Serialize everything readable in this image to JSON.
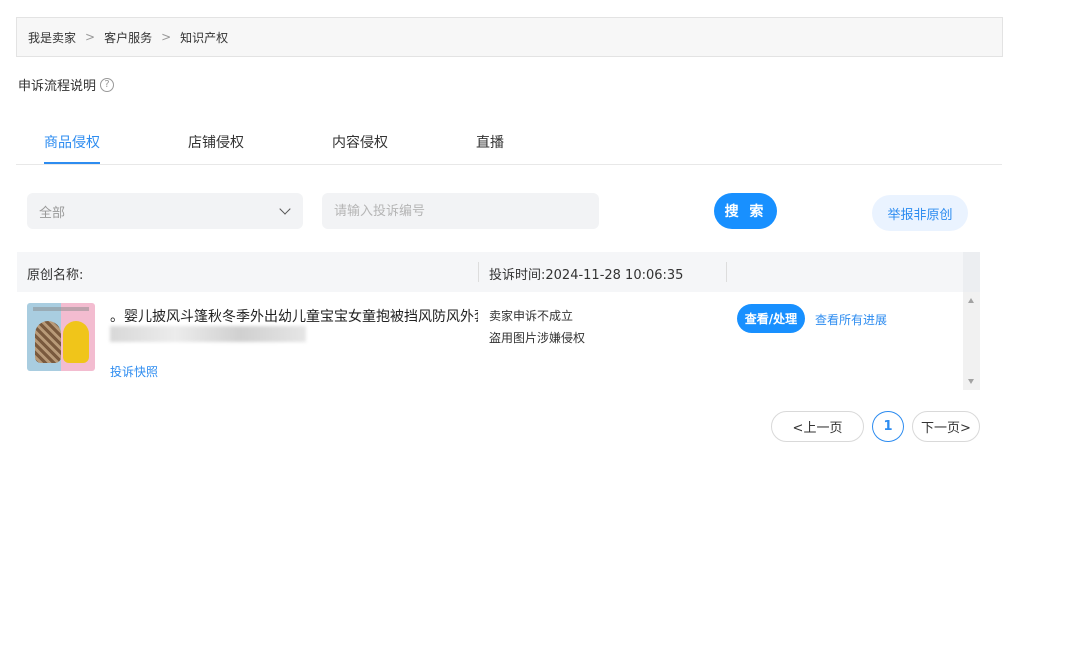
{
  "breadcrumb": {
    "items": [
      "我是卖家",
      "客户服务",
      "知识产权"
    ],
    "separator": ">"
  },
  "appeal_help": {
    "label": "申诉流程说明",
    "icon": "question-circle-icon"
  },
  "tabs": [
    {
      "label": "商品侵权",
      "active": true
    },
    {
      "label": "店铺侵权",
      "active": false
    },
    {
      "label": "内容侵权",
      "active": false
    },
    {
      "label": "直播",
      "active": false
    }
  ],
  "filter": {
    "select_value": "全部",
    "search_placeholder": "请输入投诉编号",
    "search_button": "搜 索",
    "report_button": "举报非原创"
  },
  "table": {
    "headers": {
      "original_name": "原创名称:",
      "complaint_time": "投诉时间:2024-11-28 10:06:35"
    },
    "rows": [
      {
        "title": "。婴儿披风斗篷秋冬季外出幼儿童宝宝女童抱被挡风防风外套",
        "snapshot_link": "投诉快照",
        "status": "卖家申诉不成立",
        "reason": "盗用图片涉嫌侵权",
        "view_button": "查看/处理",
        "progress_link": "查看所有进展"
      }
    ]
  },
  "pagination": {
    "prev": "<上一页",
    "current": "1",
    "next": "下一页>"
  },
  "colors": {
    "accent": "#1890ff",
    "link": "#2d8cf0"
  }
}
